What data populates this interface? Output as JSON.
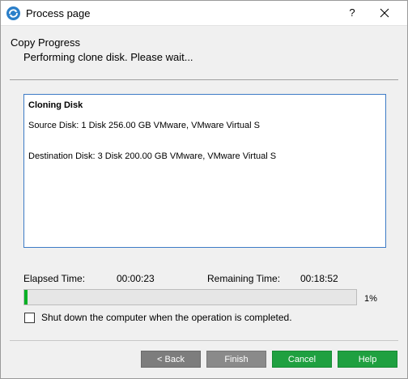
{
  "window": {
    "title": "Process page",
    "help_glyph": "?",
    "icons": {
      "app": "app-logo-icon",
      "close": "close-icon"
    }
  },
  "header": {
    "title": "Copy Progress",
    "subtitle": "Performing clone disk. Please wait..."
  },
  "log": {
    "title": "Cloning Disk",
    "lines": [
      "Source Disk: 1 Disk 256.00 GB VMware, VMware Virtual S",
      "Destination Disk: 3 Disk 200.00 GB VMware, VMware Virtual S"
    ]
  },
  "timing": {
    "elapsed_label": "Elapsed Time:",
    "elapsed_value": "00:00:23",
    "remaining_label": "Remaining Time:",
    "remaining_value": "00:18:52"
  },
  "progress": {
    "percent": 1,
    "percent_label": "1%"
  },
  "shutdown_option": {
    "label": "Shut down the computer when the operation is completed.",
    "checked": false
  },
  "buttons": {
    "back": "< Back",
    "finish": "Finish",
    "cancel": "Cancel",
    "help": "Help"
  },
  "colors": {
    "progress_fill": "#06b025",
    "primary_button": "#1fa040",
    "disabled_button": "#7d7d7d",
    "log_border": "#3d7bc6"
  }
}
